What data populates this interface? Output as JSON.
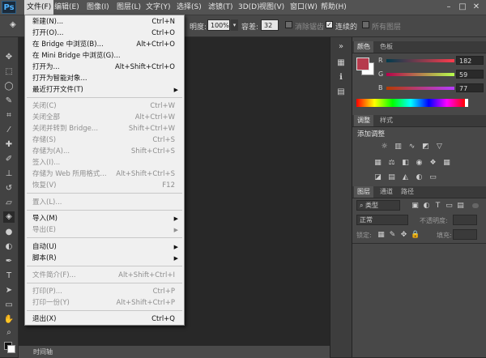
{
  "app": {
    "logo": "Ps"
  },
  "menubar": {
    "items": [
      "文件(F)",
      "编辑(E)",
      "图像(I)",
      "图层(L)",
      "文字(Y)",
      "选择(S)",
      "滤镜(T)",
      "3D(D)",
      "视图(V)",
      "窗口(W)",
      "帮助(H)"
    ],
    "window_controls": [
      "–",
      "□",
      "✕"
    ]
  },
  "options": {
    "opacity_label": "明度:",
    "opacity_value": "100%",
    "tolerance_label": "容差:",
    "tolerance_value": "32",
    "antialias_label": "消除锯齿",
    "contiguous_label": "连续的",
    "all_layers_label": "所有图层"
  },
  "file_menu": {
    "items": [
      {
        "label": "新建(N)...",
        "shortcut": "Ctrl+N"
      },
      {
        "label": "打开(O)...",
        "shortcut": "Ctrl+O"
      },
      {
        "label": "在 Bridge 中浏览(B)...",
        "shortcut": "Alt+Ctrl+O"
      },
      {
        "label": "在 Mini Bridge 中浏览(G)...",
        "shortcut": ""
      },
      {
        "label": "打开为...",
        "shortcut": "Alt+Shift+Ctrl+O"
      },
      {
        "label": "打开为智能对象...",
        "shortcut": ""
      },
      {
        "label": "最近打开文件(T)",
        "shortcut": ""
      },
      {
        "label": "关闭(C)",
        "shortcut": "Ctrl+W"
      },
      {
        "label": "关闭全部",
        "shortcut": "Alt+Ctrl+W"
      },
      {
        "label": "关闭并转到 Bridge...",
        "shortcut": "Shift+Ctrl+W"
      },
      {
        "label": "存储(S)",
        "shortcut": "Ctrl+S"
      },
      {
        "label": "存储为(A)...",
        "shortcut": "Shift+Ctrl+S"
      },
      {
        "label": "签入(I)...",
        "shortcut": ""
      },
      {
        "label": "存储为 Web 所用格式...",
        "shortcut": "Alt+Shift+Ctrl+S"
      },
      {
        "label": "恢复(V)",
        "shortcut": "F12"
      },
      {
        "label": "置入(L)...",
        "shortcut": ""
      },
      {
        "label": "导入(M)",
        "shortcut": ""
      },
      {
        "label": "导出(E)",
        "shortcut": ""
      },
      {
        "label": "自动(U)",
        "shortcut": ""
      },
      {
        "label": "脚本(R)",
        "shortcut": ""
      },
      {
        "label": "文件简介(F)...",
        "shortcut": "Alt+Shift+Ctrl+I"
      },
      {
        "label": "打印(P)...",
        "shortcut": "Ctrl+P"
      },
      {
        "label": "打印一份(Y)",
        "shortcut": "Alt+Shift+Ctrl+P"
      },
      {
        "label": "退出(X)",
        "shortcut": "Ctrl+Q"
      }
    ]
  },
  "color_panel": {
    "tabs": [
      "颜色",
      "色板"
    ],
    "channels": [
      {
        "label": "R",
        "value": "182"
      },
      {
        "label": "G",
        "value": "59"
      },
      {
        "label": "B",
        "value": "77"
      }
    ],
    "foreground": "#b63b4d"
  },
  "adjust_panel": {
    "tabs": [
      "调整",
      "样式"
    ],
    "title": "添加调整"
  },
  "layers_panel": {
    "tabs": [
      "图层",
      "通道",
      "路径"
    ],
    "filter_label": "类型",
    "blend_mode": "正常",
    "opacity_label": "不透明度:",
    "lock_label": "锁定:",
    "fill_label": "填充:"
  },
  "timeline": {
    "label": "时间轴"
  }
}
